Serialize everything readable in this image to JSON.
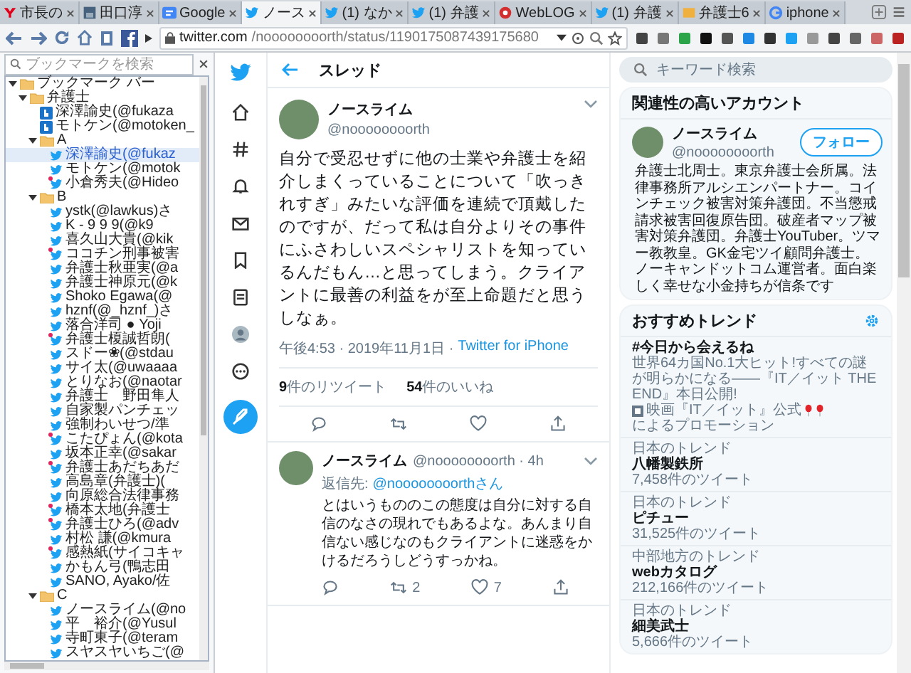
{
  "tabs": [
    {
      "title": "市長の",
      "kind": "yahoo",
      "selected": false
    },
    {
      "title": "田口淳",
      "kind": "photo",
      "selected": false
    },
    {
      "title": "Google",
      "kind": "news",
      "selected": false
    },
    {
      "title": "ノース",
      "kind": "twitter",
      "selected": true
    },
    {
      "title": "(1) なか",
      "kind": "twitter",
      "selected": false
    },
    {
      "title": "(1) 弁護",
      "kind": "twitter",
      "selected": false
    },
    {
      "title": "WebLOG",
      "kind": "weblog",
      "selected": false
    },
    {
      "title": "(1) 弁護",
      "kind": "twitter",
      "selected": false
    },
    {
      "title": "弁護士6",
      "kind": "folder",
      "selected": false
    },
    {
      "title": "iphone",
      "kind": "google",
      "selected": false
    }
  ],
  "toolbar": {
    "url_host": "twitter.com",
    "url_path": "/noooooooorth/status/1190175087439175680"
  },
  "bookmarks": {
    "search_placeholder": "ブックマークを検索",
    "tree": [
      {
        "title": "ブックマーク バー",
        "kind": "folder",
        "expanded": true,
        "selected": false,
        "children": [
          {
            "title": "弁護士",
            "kind": "folder",
            "expanded": true,
            "selected": false,
            "children": [
              {
                "title": "深澤諭史(@fukaza",
                "kind": "hatena",
                "selected": false,
                "dot": false
              },
              {
                "title": "モトケン(@motoken_",
                "kind": "hatena",
                "selected": false,
                "dot": false
              },
              {
                "title": "A",
                "kind": "folder",
                "expanded": true,
                "selected": false,
                "children": [
                  {
                    "title": "深澤諭史(@fukaz",
                    "kind": "twitter",
                    "selected": true,
                    "dot": false
                  },
                  {
                    "title": "モトケン(@motok",
                    "kind": "twitter",
                    "selected": false,
                    "dot": false
                  },
                  {
                    "title": "小倉秀夫(@Hideo",
                    "kind": "twitter",
                    "selected": false,
                    "dot": true
                  }
                ]
              },
              {
                "title": "B",
                "kind": "folder",
                "expanded": true,
                "selected": false,
                "children": [
                  {
                    "title": "ystk(@lawkus)さ",
                    "kind": "twitter",
                    "selected": false,
                    "dot": false
                  },
                  {
                    "title": "K - 9 9 9(@k9",
                    "kind": "twitter",
                    "selected": false,
                    "dot": false
                  },
                  {
                    "title": "喜久山大貴(@kik",
                    "kind": "twitter",
                    "selected": false,
                    "dot": false
                  },
                  {
                    "title": "ココチン刑事被害",
                    "kind": "twitter",
                    "selected": false,
                    "dot": true
                  },
                  {
                    "title": "弁護士秋亜実(@a",
                    "kind": "twitter",
                    "selected": false,
                    "dot": false
                  },
                  {
                    "title": "弁護士神原元(@k",
                    "kind": "twitter",
                    "selected": false,
                    "dot": false
                  },
                  {
                    "title": "Shoko Egawa(@",
                    "kind": "twitter",
                    "selected": false,
                    "dot": false
                  },
                  {
                    "title": "hznf(@_hznf_)さ",
                    "kind": "twitter",
                    "selected": false,
                    "dot": false
                  },
                  {
                    "title": "落合洋司 ● Yoji",
                    "kind": "twitter",
                    "selected": false,
                    "dot": false
                  },
                  {
                    "title": "弁護士榎誠哲朗(",
                    "kind": "twitter",
                    "selected": false,
                    "dot": true
                  },
                  {
                    "title": "スドー❀(@stdau",
                    "kind": "twitter",
                    "selected": false,
                    "dot": false
                  },
                  {
                    "title": "サイ太(@uwaaaa",
                    "kind": "twitter",
                    "selected": false,
                    "dot": false
                  },
                  {
                    "title": "とりなお(@naotar",
                    "kind": "twitter",
                    "selected": false,
                    "dot": false
                  },
                  {
                    "title": "弁護士　野田隼人",
                    "kind": "twitter",
                    "selected": false,
                    "dot": false
                  },
                  {
                    "title": "自家製パンチェッ",
                    "kind": "twitter",
                    "selected": false,
                    "dot": false
                  },
                  {
                    "title": "強制わいせつ/準",
                    "kind": "twitter",
                    "selected": false,
                    "dot": false
                  },
                  {
                    "title": "こたぴょん(@kota",
                    "kind": "twitter",
                    "selected": false,
                    "dot": true
                  },
                  {
                    "title": "坂本正幸(@sakar",
                    "kind": "twitter",
                    "selected": false,
                    "dot": false
                  },
                  {
                    "title": "弁護士あだちあだ",
                    "kind": "twitter",
                    "selected": false,
                    "dot": true
                  },
                  {
                    "title": "高島章(弁護士)(",
                    "kind": "twitter",
                    "selected": false,
                    "dot": false
                  },
                  {
                    "title": "向原総合法律事務",
                    "kind": "twitter",
                    "selected": false,
                    "dot": false
                  },
                  {
                    "title": "橋本太地(弁護士",
                    "kind": "twitter",
                    "selected": false,
                    "dot": true
                  },
                  {
                    "title": "弁護士ひろ(@adv",
                    "kind": "twitter",
                    "selected": false,
                    "dot": true
                  },
                  {
                    "title": "村松 謙(@kmura",
                    "kind": "twitter",
                    "selected": false,
                    "dot": false
                  },
                  {
                    "title": "感熱紙(サイコキャ",
                    "kind": "twitter",
                    "selected": false,
                    "dot": true
                  },
                  {
                    "title": "かもん弓(鴨志田",
                    "kind": "twitter",
                    "selected": false,
                    "dot": false
                  },
                  {
                    "title": "SANO, Ayako/佐",
                    "kind": "twitter",
                    "selected": false,
                    "dot": false
                  }
                ]
              },
              {
                "title": "C",
                "kind": "folder",
                "expanded": true,
                "selected": false,
                "children": [
                  {
                    "title": "ノースライム(@no",
                    "kind": "twitter",
                    "selected": false,
                    "dot": false
                  },
                  {
                    "title": "平　裕介(@Yusul",
                    "kind": "twitter",
                    "selected": false,
                    "dot": false
                  },
                  {
                    "title": "寺町東子(@teram",
                    "kind": "twitter",
                    "selected": false,
                    "dot": false
                  },
                  {
                    "title": "スヤスヤいちご(@",
                    "kind": "twitter",
                    "selected": false,
                    "dot": false
                  }
                ]
              }
            ]
          }
        ]
      }
    ]
  },
  "thread": {
    "header": "スレッド",
    "tweet": {
      "name": "ノースライム",
      "handle": "@noooooooorth",
      "text": "自分で受忍せずに他の士業や弁護士を紹介しまくっていることについて「吹っきれすぎ」みたいな評価を連続で頂戴したのですが、だって私は自分よりその事件にふさわしいスペシャリストを知っているんだもん…と思ってしまう。クライアントに最善の利益をが至上命題だと思うしなぁ。",
      "time": "午後4:53 · 2019年11月1日 ·",
      "source": "Twitter for iPhone",
      "retweets": "**9**件のリツイート",
      "likes": "**54**件のいいね"
    },
    "reply": {
      "name": "ノースライム",
      "handle_time": "@noooooooorth · 4h",
      "reply_to_label": "返信先:",
      "reply_to": "@noooooooorthさん",
      "text": "とはいうもののこの態度は自分に対する自信のなさの現れでもあるよな。あんまり自信ない感じなのもクライアントに迷惑をかけるだろうしどうすっかね。",
      "retweets": "2",
      "likes": "7"
    }
  },
  "sidebar": {
    "search_placeholder": "キーワード検索",
    "related": {
      "title": "関連性の高いアカウント",
      "name": "ノースライム",
      "handle": "@noooooooorth",
      "follow": "フォロー",
      "bio": "弁護士北周士。東京弁護士会所属。法律事務所アルシエンパートナー。コインチェック被害対策弁護団。不当懲戒請求被害回復原告団。破産者マップ被害対策弁護団。弁護士YouTuber。ツマー教教皇。GK金宅ツイ顧問弁護士。ノーキャンドットコム運営者。面白楽しく幸せな小金持ちが信条です"
    },
    "trends": {
      "title": "おすすめトレンド",
      "items": [
        {
          "kind": "promoted",
          "title": "#今日から会えるね",
          "description": "世界64カ国No.1大ヒット!すべての謎が明らかになる——『IT／イット THE END』本日公開!",
          "promoter": "映画『IT／イット』公式",
          "promo_label": "によるプロモーション"
        },
        {
          "kind": "trend",
          "context": "日本のトレンド",
          "title": "八幡製鉄所",
          "count": "7,458件のツイート"
        },
        {
          "kind": "trend",
          "context": "日本のトレンド",
          "title": "ピチュー",
          "count": "31,525件のツイート"
        },
        {
          "kind": "trend",
          "context": "中部地方のトレンド",
          "title": "webカタログ",
          "count": "212,166件のツイート"
        },
        {
          "kind": "trend",
          "context": "日本のトレンド",
          "title": "細美武士",
          "count": "5,666件のツイート"
        }
      ]
    }
  }
}
